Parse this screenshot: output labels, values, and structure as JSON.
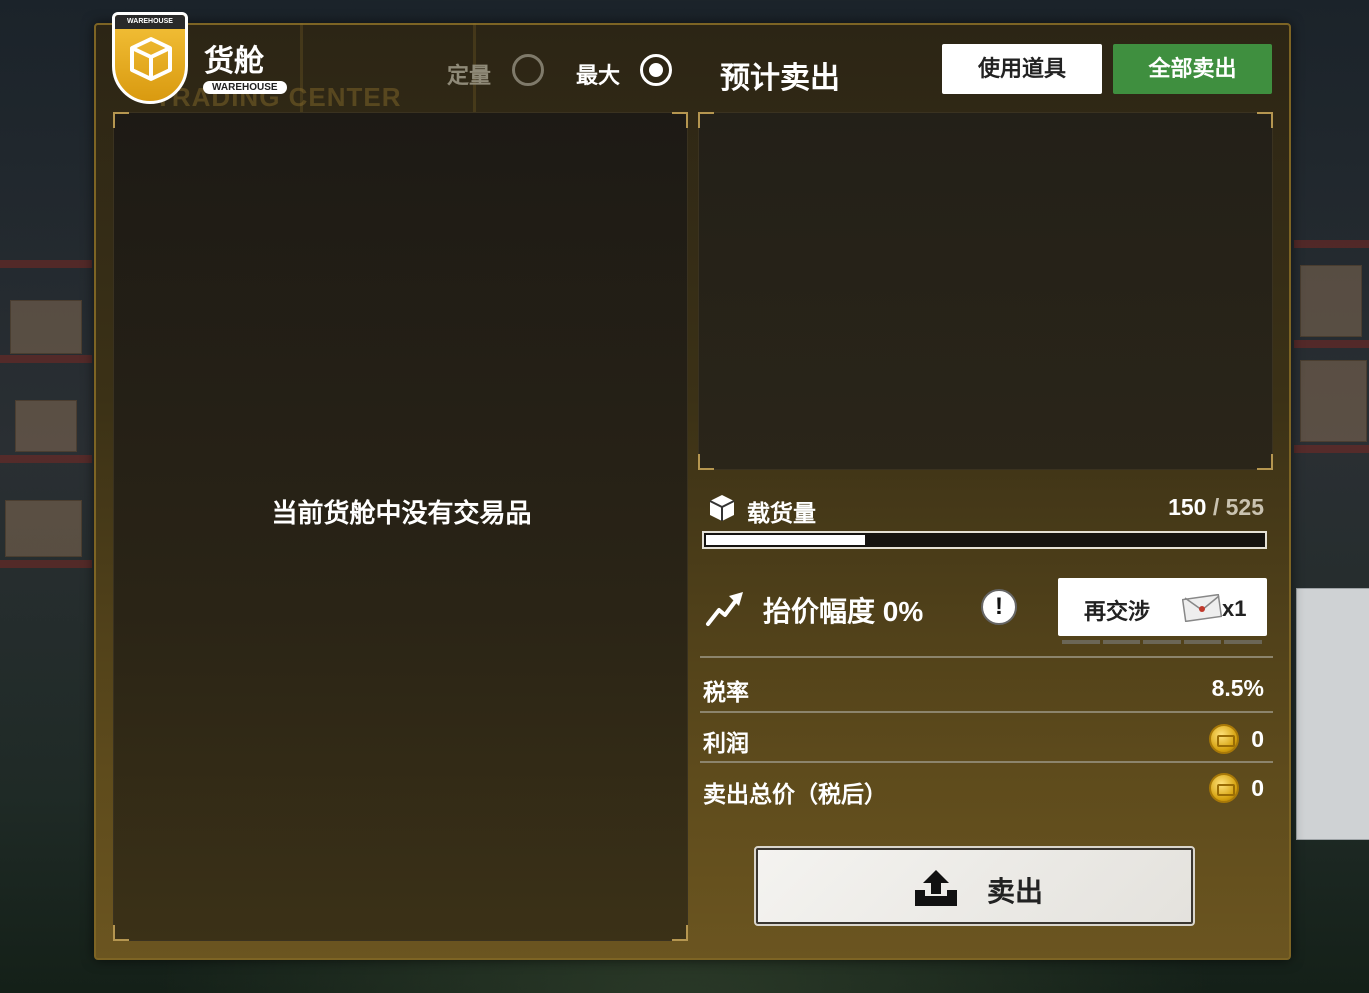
{
  "header": {
    "badge_tag": "WAREHOUSE",
    "title": "货舱",
    "title_tag": "WAREHOUSE",
    "watermark": "TRADING CENTER"
  },
  "modes": {
    "fixed_label": "定量",
    "max_label": "最大",
    "selected": "最大"
  },
  "estimate_title": "预计卖出",
  "buttons": {
    "use_item": "使用道具",
    "sell_all": "全部卖出",
    "sell": "卖出",
    "renegotiate": "再交涉",
    "renegotiate_count": "x1"
  },
  "inventory": {
    "empty_message": "当前货舱中没有交易品"
  },
  "cargo": {
    "label": "载货量",
    "current": "150",
    "separator": "/",
    "capacity": "525",
    "fill_fraction": 0.2857
  },
  "price_increase": {
    "label": "抬价幅度 0%"
  },
  "summary": {
    "tax_label": "税率",
    "tax_value": "8.5%",
    "profit_label": "利润",
    "profit_value": "0",
    "total_label": "卖出总价（税后）",
    "total_value": "0"
  },
  "colors": {
    "accent_gold": "#f4c23a",
    "sell_all_green": "#3f8f3f",
    "panel_border": "#7d6424"
  },
  "icons": {
    "badge": "cube-icon",
    "cargo": "cube-icon",
    "price": "trend-up-arrow-icon",
    "alert": "exclamation-icon",
    "renegotiate": "envelope-icon",
    "coin": "gold-coin-icon",
    "sell": "upload-tray-icon"
  }
}
